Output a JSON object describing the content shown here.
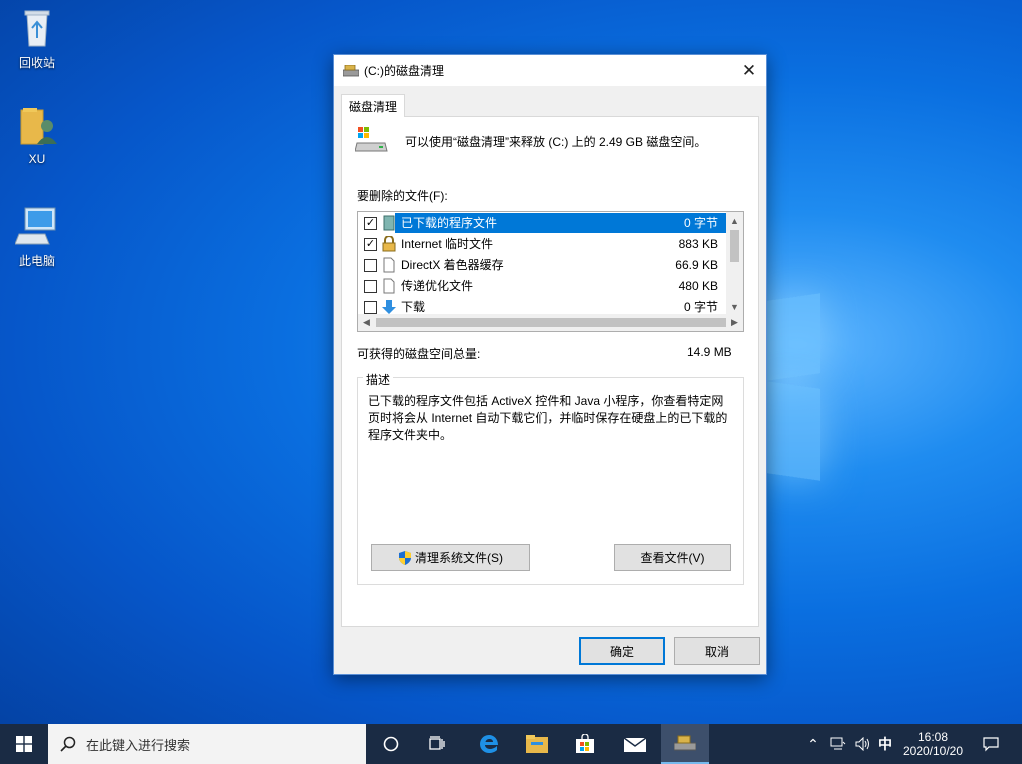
{
  "desktop": {
    "icons": [
      {
        "label": "回收站"
      },
      {
        "label": "XU"
      },
      {
        "label": "此电脑"
      }
    ]
  },
  "dialog": {
    "title": "(C:)的磁盘清理",
    "tab_label": "磁盘清理",
    "info_text": "可以使用“磁盘清理”来释放  (C:) 上的 2.49 GB 磁盘空间。",
    "files_label": "要删除的文件(F):",
    "files": [
      {
        "name": "已下载的程序文件",
        "size": "0 字节",
        "checked": true,
        "selected": true
      },
      {
        "name": "Internet 临时文件",
        "size": "883 KB",
        "checked": true,
        "selected": false
      },
      {
        "name": "DirectX 着色器缓存",
        "size": "66.9 KB",
        "checked": false,
        "selected": false
      },
      {
        "name": "传递优化文件",
        "size": "480 KB",
        "checked": false,
        "selected": false
      },
      {
        "name": "下载",
        "size": "0 字节",
        "checked": false,
        "selected": false
      }
    ],
    "total_label": "可获得的磁盘空间总量:",
    "total_value": "14.9 MB",
    "desc_title": "描述",
    "desc_text": "已下载的程序文件包括 ActiveX 控件和 Java 小程序，你查看特定网页时将会从 Internet 自动下载它们，并临时保存在硬盘上的已下载的程序文件夹中。",
    "cleanup_system_label": "清理系统文件(S)",
    "view_files_label": "查看文件(V)",
    "ok_label": "确定",
    "cancel_label": "取消",
    "check_mark": "✓"
  },
  "taskbar": {
    "search_placeholder": "在此键入进行搜索",
    "ime": "中",
    "time": "16:08",
    "date": "2020/10/20"
  },
  "colors": {
    "selection": "#0078d7",
    "taskbar": "#1a2b44"
  }
}
